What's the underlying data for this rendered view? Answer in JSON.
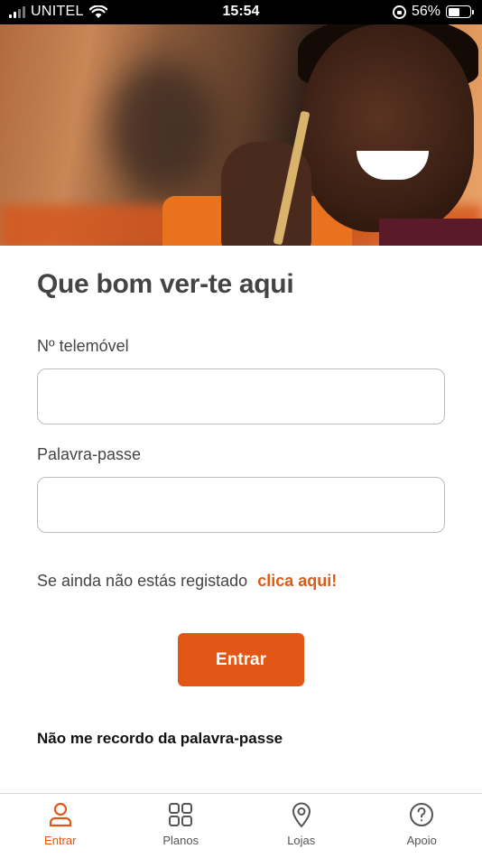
{
  "status_bar": {
    "carrier": "UNITEL",
    "time": "15:54",
    "battery_percent": "56%",
    "battery_level": 0.56,
    "icons": [
      "signal-icon",
      "wifi-icon",
      "rotation-lock-icon",
      "battery-icon"
    ]
  },
  "hero": {
    "image": "smiling-man-on-phone-photo"
  },
  "login": {
    "title": "Que bom ver-te aqui",
    "phone_label": "Nº telemóvel",
    "phone_value": "",
    "password_label": "Palavra-passe",
    "password_value": "",
    "register_text": "Se ainda não estás registado",
    "register_link": "clica aqui!",
    "submit_label": "Entrar",
    "forgot_password": "Não me recordo da palavra-passe"
  },
  "colors": {
    "accent": "#e25716",
    "text": "#444444"
  },
  "bottom_nav": {
    "items": [
      {
        "label": "Entrar",
        "icon": "user-icon",
        "active": true
      },
      {
        "label": "Planos",
        "icon": "grid-icon",
        "active": false
      },
      {
        "label": "Lojas",
        "icon": "location-pin-icon",
        "active": false
      },
      {
        "label": "Apoio",
        "icon": "help-circle-icon",
        "active": false
      }
    ]
  }
}
